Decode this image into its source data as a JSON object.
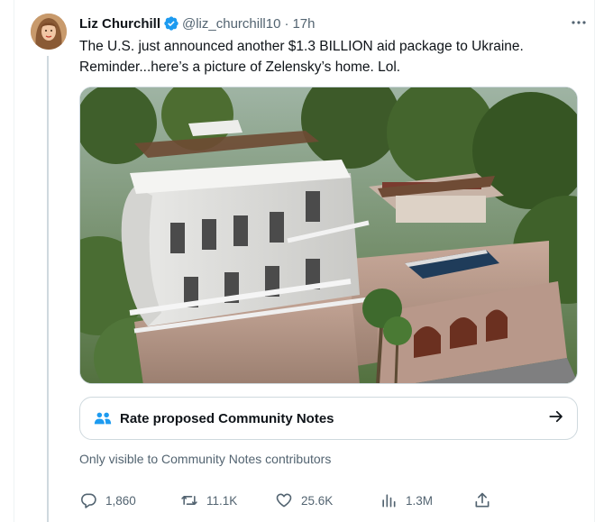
{
  "author": {
    "name": "Liz Churchill",
    "handle": "@liz_churchill10",
    "separator": "·",
    "time": "17h",
    "verified": true
  },
  "tweet": {
    "line1": "The U.S. just announced another $1.3 BILLION aid package to Ukraine.",
    "line2": "Reminder...here’s a picture of Zelensky’s home. Lol."
  },
  "community_notes": {
    "label": "Rate proposed Community Notes",
    "visibility": "Only visible to Community Notes contributors"
  },
  "actions": {
    "replies": "1,860",
    "reposts": "11.1K",
    "likes": "25.6K",
    "views": "1.3M"
  },
  "icons": {
    "more": "more-icon",
    "verified": "verified-badge-icon",
    "notes": "community-notes-icon",
    "arrow": "arrow-right-icon",
    "reply": "reply-icon",
    "repost": "repost-icon",
    "like": "like-icon",
    "views": "views-icon",
    "share": "share-icon"
  },
  "colors": {
    "accent": "#1d9bf0",
    "text": "#0f1419",
    "secondary": "#536471",
    "border": "#cfd9de"
  }
}
